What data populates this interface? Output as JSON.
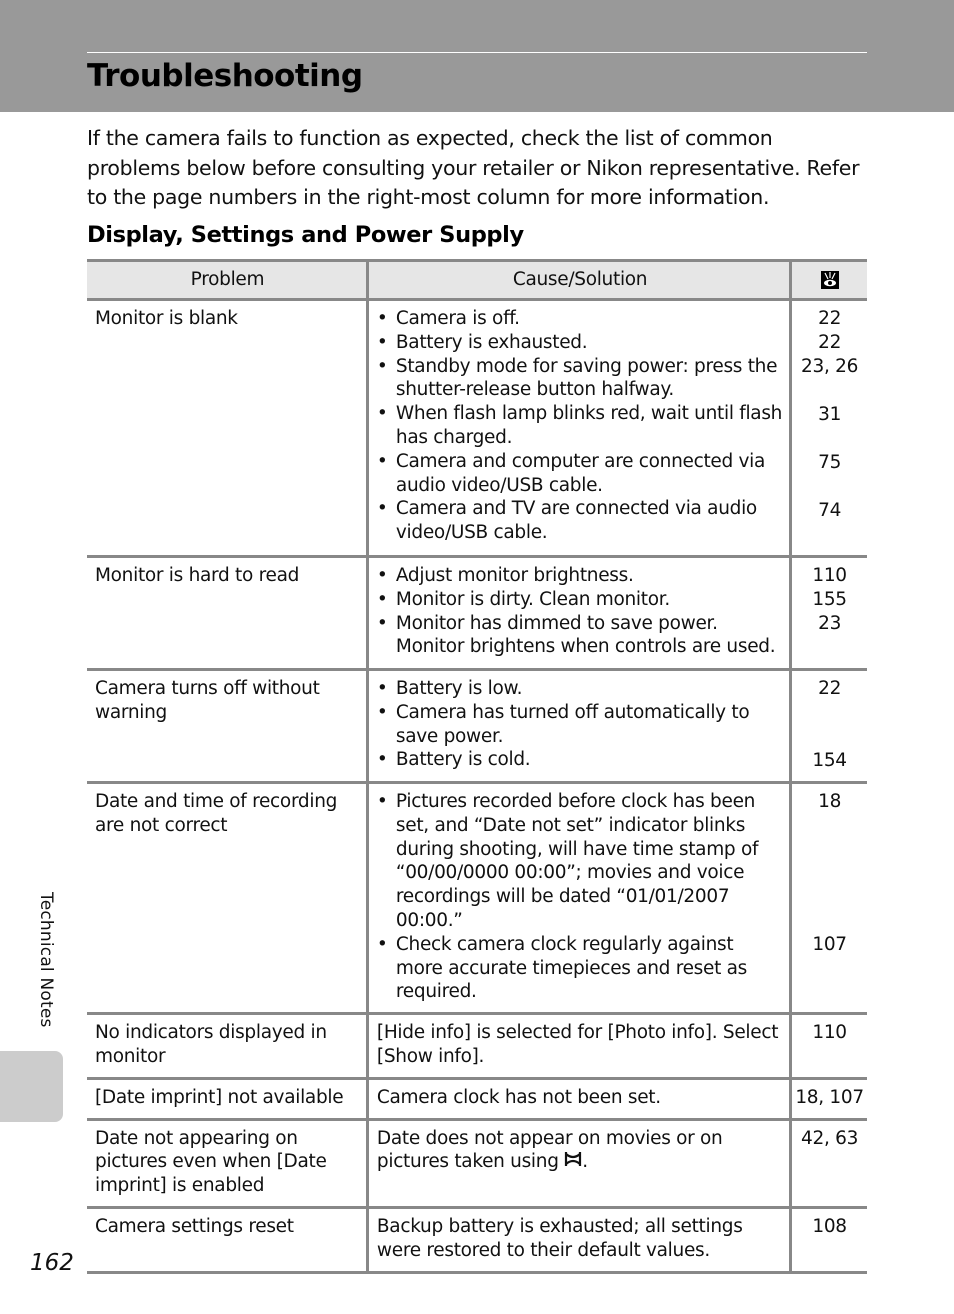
{
  "header": {
    "title": "Troubleshooting"
  },
  "intro": "If the camera fails to function as expected, check the list of common problems below before consulting your retailer or Nikon representative. Refer to the page numbers in the right-most column for more information.",
  "section": {
    "title": "Display, Settings and Power Supply"
  },
  "table": {
    "headers": {
      "problem": "Problem",
      "cause": "Cause/Solution",
      "page_icon": "page-reference-icon"
    },
    "rows": [
      {
        "problem": "Monitor is blank",
        "causes": [
          "Camera is off.",
          "Battery is exhausted.",
          "Standby mode for saving power: press the shutter-release button halfway.",
          "When flash lamp blinks red, wait until flash has charged.",
          "Camera and computer are connected via audio video/USB cable.",
          "Camera and TV are connected via audio video/USB cable."
        ],
        "pages": [
          "22",
          "22",
          "23, 26",
          "31",
          "75",
          "74"
        ],
        "bulleted": true
      },
      {
        "problem": "Monitor is hard to read",
        "causes": [
          "Adjust monitor brightness.",
          "Monitor is dirty. Clean monitor.",
          "Monitor has dimmed to save power. Monitor brightens when controls are used."
        ],
        "pages": [
          "110",
          "155",
          "23"
        ],
        "bulleted": true
      },
      {
        "problem": "Camera turns off without warning",
        "causes": [
          "Battery is low.",
          "Camera has turned off automatically to save power.",
          "Battery is cold."
        ],
        "pages": [
          "22",
          "",
          "154"
        ],
        "bulleted": true
      },
      {
        "problem": "Date and time of recording are not correct",
        "causes": [
          "Pictures recorded before clock has been set, and “Date not set” indicator blinks during shooting, will have time stamp of “00/00/0000 00:00”; movies and voice recordings will be dated “01/01/2007 00:00.”",
          "Check camera clock regularly against more accurate timepieces and reset as required."
        ],
        "pages": [
          "18",
          "107"
        ],
        "bulleted": true
      },
      {
        "problem": "No indicators displayed in monitor",
        "causes": [
          "[Hide info] is selected for [Photo info]. Select [Show info]."
        ],
        "pages": [
          "110"
        ],
        "bulleted": false
      },
      {
        "problem": "[Date imprint] not available",
        "causes": [
          "Camera clock has not been set."
        ],
        "pages": [
          "18, 107"
        ],
        "bulleted": false
      },
      {
        "problem": "Date not appearing on pictures even when [Date imprint] is enabled",
        "causes": [
          "Date does not appear on movies or on pictures taken using"
        ],
        "cause_suffix_icon": "panorama-assist-icon",
        "cause_suffix_text": ".",
        "pages": [
          "42, 63"
        ],
        "bulleted": false
      },
      {
        "problem": "Camera settings reset",
        "causes": [
          "Backup battery is exhausted; all settings were restored to their default values."
        ],
        "pages": [
          "108"
        ],
        "bulleted": false
      }
    ]
  },
  "side_tab": {
    "label": "Technical Notes"
  },
  "footer": {
    "page_number": "162"
  }
}
